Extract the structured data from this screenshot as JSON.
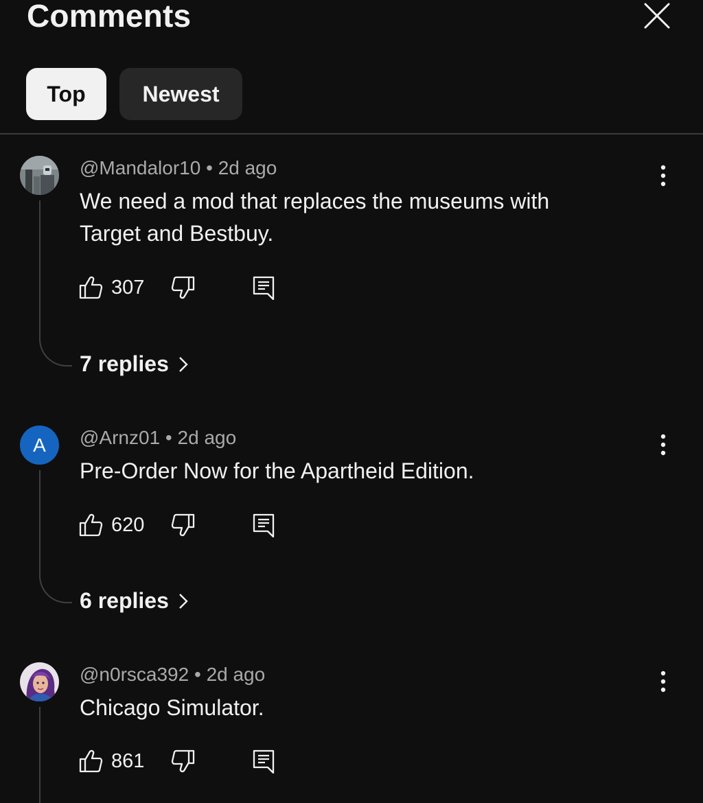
{
  "header": {
    "title": "Comments"
  },
  "filters": {
    "top": "Top",
    "newest": "Newest"
  },
  "comments": [
    {
      "author": "@Mandalor10",
      "time": "2d ago",
      "text": "We need a mod that replaces the museums with Target and Bestbuy.",
      "likes": "307",
      "replies": "7 replies",
      "avatar_icon": "robot-photo-avatar"
    },
    {
      "author": "@Arnz01",
      "time": "2d ago",
      "text": "Pre-Order Now for the Apartheid Edition.",
      "likes": "620",
      "replies": "6 replies",
      "avatar_letter": "A",
      "avatar_color": "#1565c0"
    },
    {
      "author": "@n0rsca392",
      "time": "2d ago",
      "text": "Chicago Simulator.",
      "likes": "861",
      "avatar_icon": "purple-hair-character-avatar"
    }
  ],
  "colors": {
    "background": "#0f0f0f",
    "chip_active": "#f1f1f1",
    "chip_inactive": "#272727",
    "secondary_text": "#aaaaaa"
  }
}
